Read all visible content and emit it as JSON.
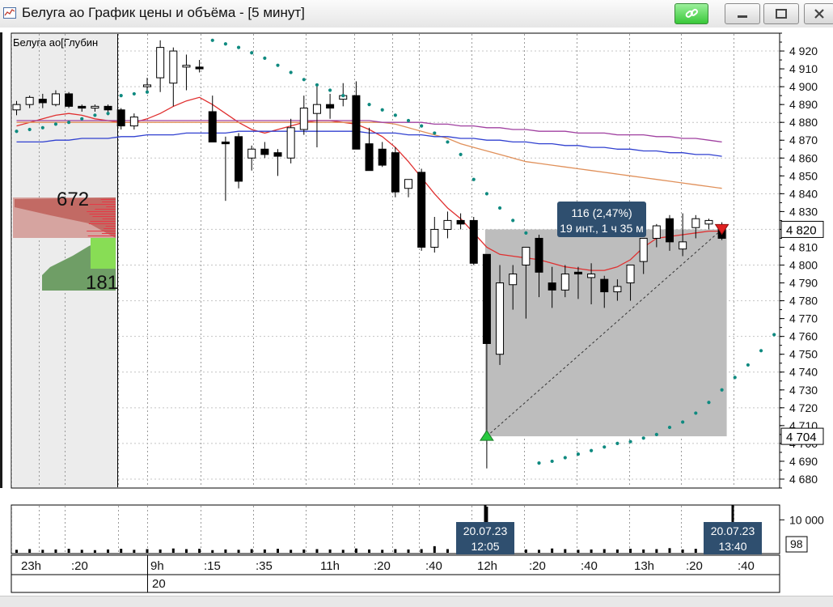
{
  "window": {
    "title": "Белуга ао График цены и объёма - [5 минут]",
    "icons": [
      "chart-app-icon",
      "link-icon",
      "minimize-icon",
      "maximize-icon",
      "close-icon"
    ]
  },
  "depth_panel": {
    "title": "Белуга ао[Глубин",
    "ask_total": "672",
    "bid_total": "181",
    "colors": {
      "ask": "#c26a64",
      "bid": "#6f9e66"
    }
  },
  "chart_data": {
    "type": "candlestick",
    "y_axis": {
      "min": 4675,
      "max": 4930,
      "ticks": [
        4680,
        4690,
        4700,
        4710,
        4720,
        4730,
        4740,
        4750,
        4760,
        4770,
        4780,
        4790,
        4800,
        4810,
        4820,
        4830,
        4840,
        4850,
        4860,
        4870,
        4880,
        4890,
        4900,
        4910,
        4920
      ],
      "tick_labels": [
        "4 680",
        "4 690",
        "4 700",
        "4 710",
        "4 720",
        "4 730",
        "4 740",
        "4 750",
        "4 760",
        "4 770",
        "4 780",
        "4 790",
        "4 800",
        "4 810",
        "4 820",
        "4 830",
        "4 840",
        "4 850",
        "4 860",
        "4 870",
        "4 880",
        "4 890",
        "4 900",
        "4 910",
        "4 920"
      ],
      "markers": [
        {
          "value": 4820,
          "label": "4 820"
        },
        {
          "value": 4704,
          "label": "4 704"
        }
      ]
    },
    "x_axis": {
      "labels": [
        "23h",
        ":20",
        "9h",
        ":15",
        ":35",
        "11h",
        ":20",
        ":40",
        "12h",
        ":20",
        ":40",
        "13h",
        ":20",
        ":40"
      ],
      "date_label": "20"
    },
    "candles": [
      [
        4887,
        4892,
        4884,
        4890
      ],
      [
        4890,
        4895,
        4888,
        4894
      ],
      [
        4893,
        4896,
        4888,
        4891
      ],
      [
        4890,
        4898,
        4889,
        4896
      ],
      [
        4896,
        4897,
        4888,
        4889
      ],
      [
        4889,
        4890,
        4886,
        4888
      ],
      [
        4888,
        4890,
        4886,
        4889
      ],
      [
        4889,
        4890,
        4884,
        4887
      ],
      [
        4887,
        4888,
        4876,
        4878
      ],
      [
        4878,
        4885,
        4876,
        4883
      ],
      [
        4900,
        4905,
        4897,
        4901
      ],
      [
        4905,
        4926,
        4897,
        4922
      ],
      [
        4902,
        4922,
        4889,
        4920
      ],
      [
        4911,
        4918,
        4898,
        4912
      ],
      [
        4911,
        4915,
        4908,
        4910
      ],
      [
        4886,
        4895,
        4870,
        4869
      ],
      [
        4869,
        4872,
        4836,
        4868
      ],
      [
        4872,
        4874,
        4843,
        4847
      ],
      [
        4860,
        4867,
        4853,
        4865
      ],
      [
        4865,
        4869,
        4860,
        4862
      ],
      [
        4863,
        4865,
        4850,
        4861
      ],
      [
        4860,
        4882,
        4857,
        4877
      ],
      [
        4876,
        4895,
        4873,
        4888
      ],
      [
        4885,
        4900,
        4866,
        4890
      ],
      [
        4890,
        4896,
        4882,
        4888
      ],
      [
        4893,
        4902,
        4889,
        4895
      ],
      [
        4895,
        4903,
        4890,
        4865
      ],
      [
        4868,
        4877,
        4857,
        4853
      ],
      [
        4865,
        4869,
        4855,
        4856
      ],
      [
        4863,
        4866,
        4838,
        4841
      ],
      [
        4843,
        4844,
        4838,
        4848
      ],
      [
        4852,
        4854,
        4808,
        4810
      ],
      [
        4810,
        4827,
        4807,
        4820
      ],
      [
        4820,
        4830,
        4815,
        4825
      ],
      [
        4825,
        4829,
        4820,
        4823
      ],
      [
        4825,
        4827,
        4800,
        4801
      ],
      [
        4806,
        4806,
        4686,
        4756
      ],
      [
        4750,
        4800,
        4744,
        4790
      ],
      [
        4789,
        4800,
        4775,
        4795
      ],
      [
        4800,
        4807,
        4770,
        4810
      ],
      [
        4815,
        4817,
        4782,
        4796
      ],
      [
        4790,
        4799,
        4776,
        4786
      ],
      [
        4786,
        4800,
        4782,
        4795
      ],
      [
        4796,
        4799,
        4781,
        4795
      ],
      [
        4793,
        4801,
        4778,
        4795
      ],
      [
        4792,
        4794,
        4776,
        4785
      ],
      [
        4785,
        4792,
        4780,
        4788
      ],
      [
        4790,
        4797,
        4780,
        4800
      ],
      [
        4802,
        4811,
        4795,
        4815
      ],
      [
        4815,
        4823,
        4810,
        4822
      ],
      [
        4826,
        4828,
        4808,
        4813
      ],
      [
        4809,
        4829,
        4805,
        4813
      ],
      [
        4821,
        4828,
        4815,
        4826
      ],
      [
        4823,
        4826,
        4820,
        4825
      ],
      [
        4820,
        4824,
        4814,
        4815
      ]
    ],
    "ma_series": [
      {
        "color": "#e03030",
        "values": [
          4878,
          4880,
          4882,
          4884,
          4885,
          4884,
          4882,
          4881,
          4880,
          4880,
          4882,
          4885,
          4889,
          4892,
          4894,
          4890,
          4885,
          4880,
          4876,
          4874,
          4876,
          4878,
          4880,
          4881,
          4881,
          4880,
          4879,
          4876,
          4872,
          4866,
          4858,
          4849,
          4840,
          4832,
          4826,
          4818,
          4810,
          4806,
          4805,
          4804,
          4803,
          4801,
          4799,
          4798,
          4797,
          4797,
          4799,
          4803,
          4810,
          4815,
          4816,
          4817,
          4818,
          4819,
          4819
        ]
      },
      {
        "color": "#e0905a",
        "values": [
          4880,
          4880,
          4880,
          4880,
          4880,
          4880,
          4880,
          4880,
          4880,
          4880,
          4880,
          4880,
          4880,
          4880,
          4880,
          4880,
          4880,
          4880,
          4880,
          4880,
          4880,
          4880,
          4880,
          4880,
          4880,
          4880,
          4880,
          4880,
          4880,
          4879,
          4877,
          4875,
          4873,
          4871,
          4868,
          4866,
          4864,
          4862,
          4860,
          4858,
          4857,
          4856,
          4855,
          4854,
          4853,
          4852,
          4851,
          4850,
          4849,
          4848,
          4847,
          4846,
          4845,
          4844,
          4843
        ]
      },
      {
        "color": "#a040a0",
        "values": [
          4881,
          4881,
          4881,
          4881,
          4881,
          4881,
          4881,
          4881,
          4881,
          4881,
          4881,
          4881,
          4881,
          4881,
          4881,
          4881,
          4881,
          4881,
          4881,
          4881,
          4881,
          4881,
          4881,
          4881,
          4881,
          4881,
          4881,
          4881,
          4880,
          4880,
          4880,
          4880,
          4879,
          4879,
          4878,
          4878,
          4877,
          4877,
          4876,
          4876,
          4875,
          4875,
          4875,
          4874,
          4874,
          4874,
          4873,
          4873,
          4873,
          4872,
          4872,
          4871,
          4871,
          4870,
          4869
        ]
      },
      {
        "color": "#3040d0",
        "values": [
          4869,
          4869,
          4869,
          4870,
          4870,
          4871,
          4871,
          4871,
          4872,
          4872,
          4873,
          4873,
          4873,
          4874,
          4874,
          4874,
          4874,
          4875,
          4875,
          4875,
          4875,
          4875,
          4875,
          4875,
          4875,
          4875,
          4875,
          4874,
          4874,
          4874,
          4873,
          4873,
          4872,
          4872,
          4871,
          4871,
          4870,
          4870,
          4869,
          4869,
          4868,
          4868,
          4867,
          4867,
          4866,
          4866,
          4865,
          4865,
          4864,
          4864,
          4863,
          4863,
          4862,
          4862,
          4861
        ]
      }
    ],
    "parabolic_sar": [
      [
        0,
        4875
      ],
      [
        1,
        4876
      ],
      [
        2,
        4877
      ],
      [
        3,
        4879
      ],
      [
        4,
        4880
      ],
      [
        5,
        4882
      ],
      [
        6,
        4884
      ],
      [
        7,
        4885
      ],
      [
        8,
        4895
      ],
      [
        9,
        4896
      ],
      [
        10,
        4897
      ],
      [
        15,
        4926
      ],
      [
        16,
        4924
      ],
      [
        17,
        4922
      ],
      [
        18,
        4919
      ],
      [
        19,
        4916
      ],
      [
        20,
        4912
      ],
      [
        21,
        4908
      ],
      [
        22,
        4904
      ],
      [
        23,
        4901
      ],
      [
        24,
        4898
      ],
      [
        25,
        4895
      ],
      [
        27,
        4890
      ],
      [
        28,
        4887
      ],
      [
        29,
        4884
      ],
      [
        30,
        4881
      ],
      [
        31,
        4878
      ],
      [
        32,
        4874
      ],
      [
        33,
        4869
      ],
      [
        34,
        4862
      ],
      [
        35,
        4848
      ],
      [
        36,
        4840
      ],
      [
        37,
        4832
      ],
      [
        38,
        4825
      ],
      [
        39,
        4818
      ],
      [
        40,
        4689
      ],
      [
        41,
        4690
      ],
      [
        42,
        4692
      ],
      [
        43,
        4694
      ],
      [
        44,
        4696
      ],
      [
        45,
        4698
      ],
      [
        46,
        4700
      ],
      [
        47,
        4701
      ],
      [
        48,
        4703
      ],
      [
        49,
        4705
      ],
      [
        50,
        4709
      ],
      [
        51,
        4712
      ],
      [
        52,
        4717
      ],
      [
        53,
        4723
      ],
      [
        54,
        4730
      ],
      [
        55,
        4737
      ],
      [
        56,
        4744
      ],
      [
        57,
        4752
      ],
      [
        58,
        4761
      ]
    ],
    "measure_box": {
      "start_index": 36,
      "end_index": 54,
      "low": 4704,
      "high": 4820,
      "label_line1": "116 (2,47%)",
      "label_line2": "19 инт., 1 ч 35 м"
    },
    "volume": {
      "ticks": [
        "10 000"
      ],
      "max": 14000,
      "values": [
        900,
        1100,
        900,
        1000,
        1200,
        900,
        800,
        1000,
        1200,
        900,
        1100,
        1000,
        1300,
        1100,
        1200,
        800,
        1000,
        900,
        1100,
        1000,
        1200,
        900,
        1000,
        1100,
        1000,
        900,
        1300,
        1000,
        900,
        1100,
        1000,
        1100,
        2000,
        1100,
        1000,
        1500,
        14000,
        1200,
        1800,
        1000,
        900,
        1300,
        1100,
        900,
        1000,
        1100,
        1000,
        1200,
        1000,
        1100,
        1400,
        1000,
        1200,
        1100,
        1000
      ],
      "counter": "98"
    },
    "crosshair_labels": [
      {
        "date": "20.07.23",
        "time": "12:05"
      },
      {
        "date": "20.07.23",
        "time": "13:40"
      }
    ],
    "colors": {
      "up_candle": "#ffffff",
      "down_candle": "#000000",
      "sar": "#0f8a80",
      "measure_box": "#bdbdbd",
      "label_bg": "#2f4f6f"
    }
  }
}
